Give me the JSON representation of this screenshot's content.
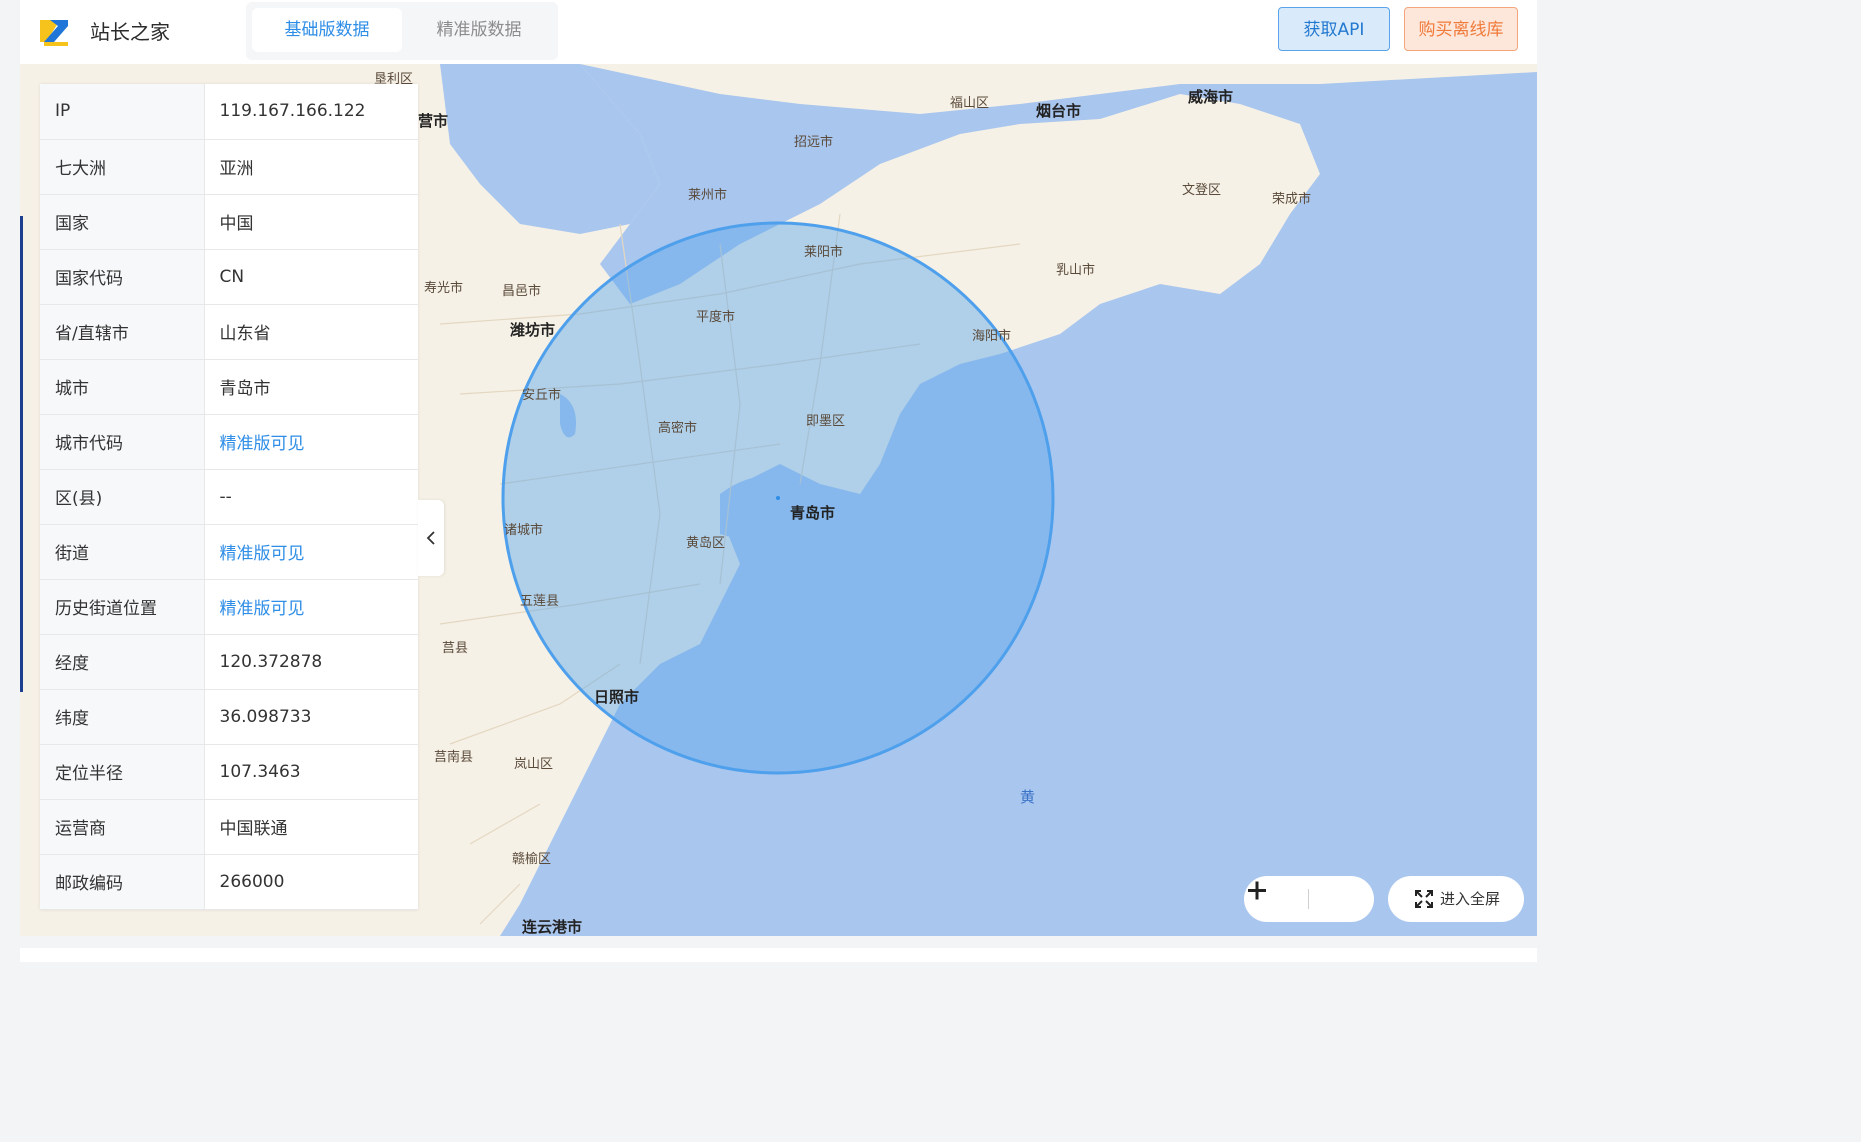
{
  "header": {
    "site_name": "站长之家",
    "tabs": [
      {
        "label": "基础版数据",
        "active": true
      },
      {
        "label": "精准版数据",
        "active": false
      }
    ],
    "api_button": "获取API",
    "buy_button": "购买离线库"
  },
  "info": [
    {
      "key": "IP",
      "value": "119.167.166.122",
      "link": false
    },
    {
      "key": "七大洲",
      "value": "亚洲",
      "link": false
    },
    {
      "key": "国家",
      "value": "中国",
      "link": false
    },
    {
      "key": "国家代码",
      "value": "CN",
      "link": false
    },
    {
      "key": "省/直辖市",
      "value": "山东省",
      "link": false
    },
    {
      "key": "城市",
      "value": "青岛市",
      "link": false
    },
    {
      "key": "城市代码",
      "value": "精准版可见",
      "link": true
    },
    {
      "key": "区(县)",
      "value": "--",
      "link": false
    },
    {
      "key": "街道",
      "value": "精准版可见",
      "link": true
    },
    {
      "key": "历史街道位置",
      "value": "精准版可见",
      "link": true
    },
    {
      "key": "经度",
      "value": "120.372878",
      "link": false
    },
    {
      "key": "纬度",
      "value": "36.098733",
      "link": false
    },
    {
      "key": "定位半径",
      "value": "107.3463",
      "link": false
    },
    {
      "key": "运营商",
      "value": "中国联通",
      "link": false
    },
    {
      "key": "邮政编码",
      "value": "266000",
      "link": false
    }
  ],
  "map": {
    "labels": {
      "yantai": "烟台市",
      "weihai": "威海市",
      "fushan": "福山区",
      "zhaoyuan": "招远市",
      "laizhou": "莱州市",
      "wendeng": "文登区",
      "rongcheng": "荣成市",
      "laiyang": "莱阳市",
      "rushan": "乳山市",
      "haiyang": "海阳市",
      "shouguang": "寿光市",
      "changyi": "昌邑市",
      "weifang": "潍坊市",
      "pingdu": "平度市",
      "anqiu": "安丘市",
      "gaomi": "高密市",
      "jimo": "即墨区",
      "qingdao": "青岛市",
      "zhucheng": "诸城市",
      "huangdao": "黄岛区",
      "wulian": "五莲县",
      "juxian": "莒县",
      "rizhao": "日照市",
      "junan": "莒南县",
      "lanshan": "岚山区",
      "ganyu": "赣榆区",
      "lianyungang": "连云港市",
      "kenli": "垦利区",
      "yingkou_part": "营市",
      "yellow_sea": "黄"
    },
    "fullscreen_label": "进入全屏",
    "zoom_in": "+",
    "zoom_out": "−",
    "colors": {
      "land": "#f6f1e6",
      "sea": "#a9c6ee",
      "circle_fill": "#5aa6ec",
      "circle_stroke": "#4fa0ec",
      "accent": "#2e8de6"
    }
  }
}
